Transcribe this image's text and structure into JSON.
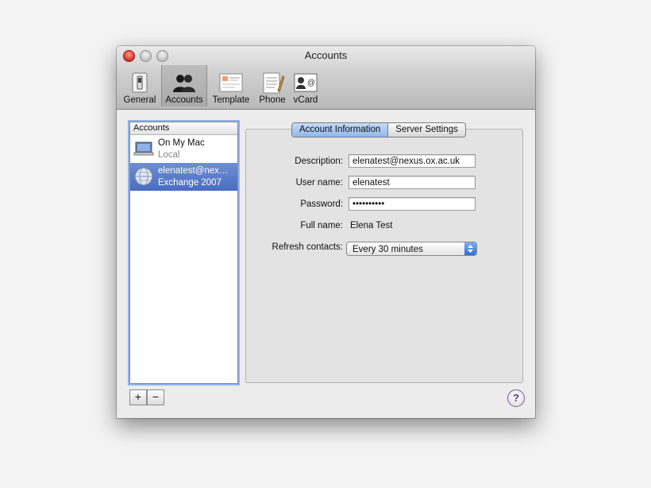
{
  "window": {
    "title": "Accounts"
  },
  "toolbar": {
    "items": [
      {
        "label": "General",
        "icon": "switch-icon"
      },
      {
        "label": "Accounts",
        "icon": "people-icon",
        "selected": true
      },
      {
        "label": "Template",
        "icon": "card-template-icon"
      },
      {
        "label": "Phone",
        "icon": "notepad-icon"
      },
      {
        "label": "vCard",
        "icon": "vcard-icon"
      }
    ]
  },
  "accounts_list": {
    "header": "Accounts",
    "items": [
      {
        "name": "On My Mac",
        "detail": "Local",
        "icon": "laptop-icon",
        "selected": false
      },
      {
        "name": "elenatest@nex…",
        "detail": "Exchange 2007",
        "icon": "globe-icon",
        "selected": true
      }
    ]
  },
  "tabs": [
    {
      "label": "Account Information",
      "active": true
    },
    {
      "label": "Server Settings",
      "active": false
    }
  ],
  "form": {
    "description_label": "Description:",
    "description_value": "elenatest@nexus.ox.ac.uk",
    "username_label": "User name:",
    "username_value": "elenatest",
    "password_label": "Password:",
    "password_value": "••••••••••",
    "fullname_label": "Full name:",
    "fullname_value": "Elena Test",
    "refresh_label": "Refresh contacts:",
    "refresh_value": "Every 30 minutes"
  },
  "buttons": {
    "add": "+",
    "remove": "−",
    "help": "?"
  },
  "colors": {
    "selection": "#4b6dc2",
    "focus_ring": "#8fb3e6",
    "tab_active": "#8fb8ec"
  }
}
